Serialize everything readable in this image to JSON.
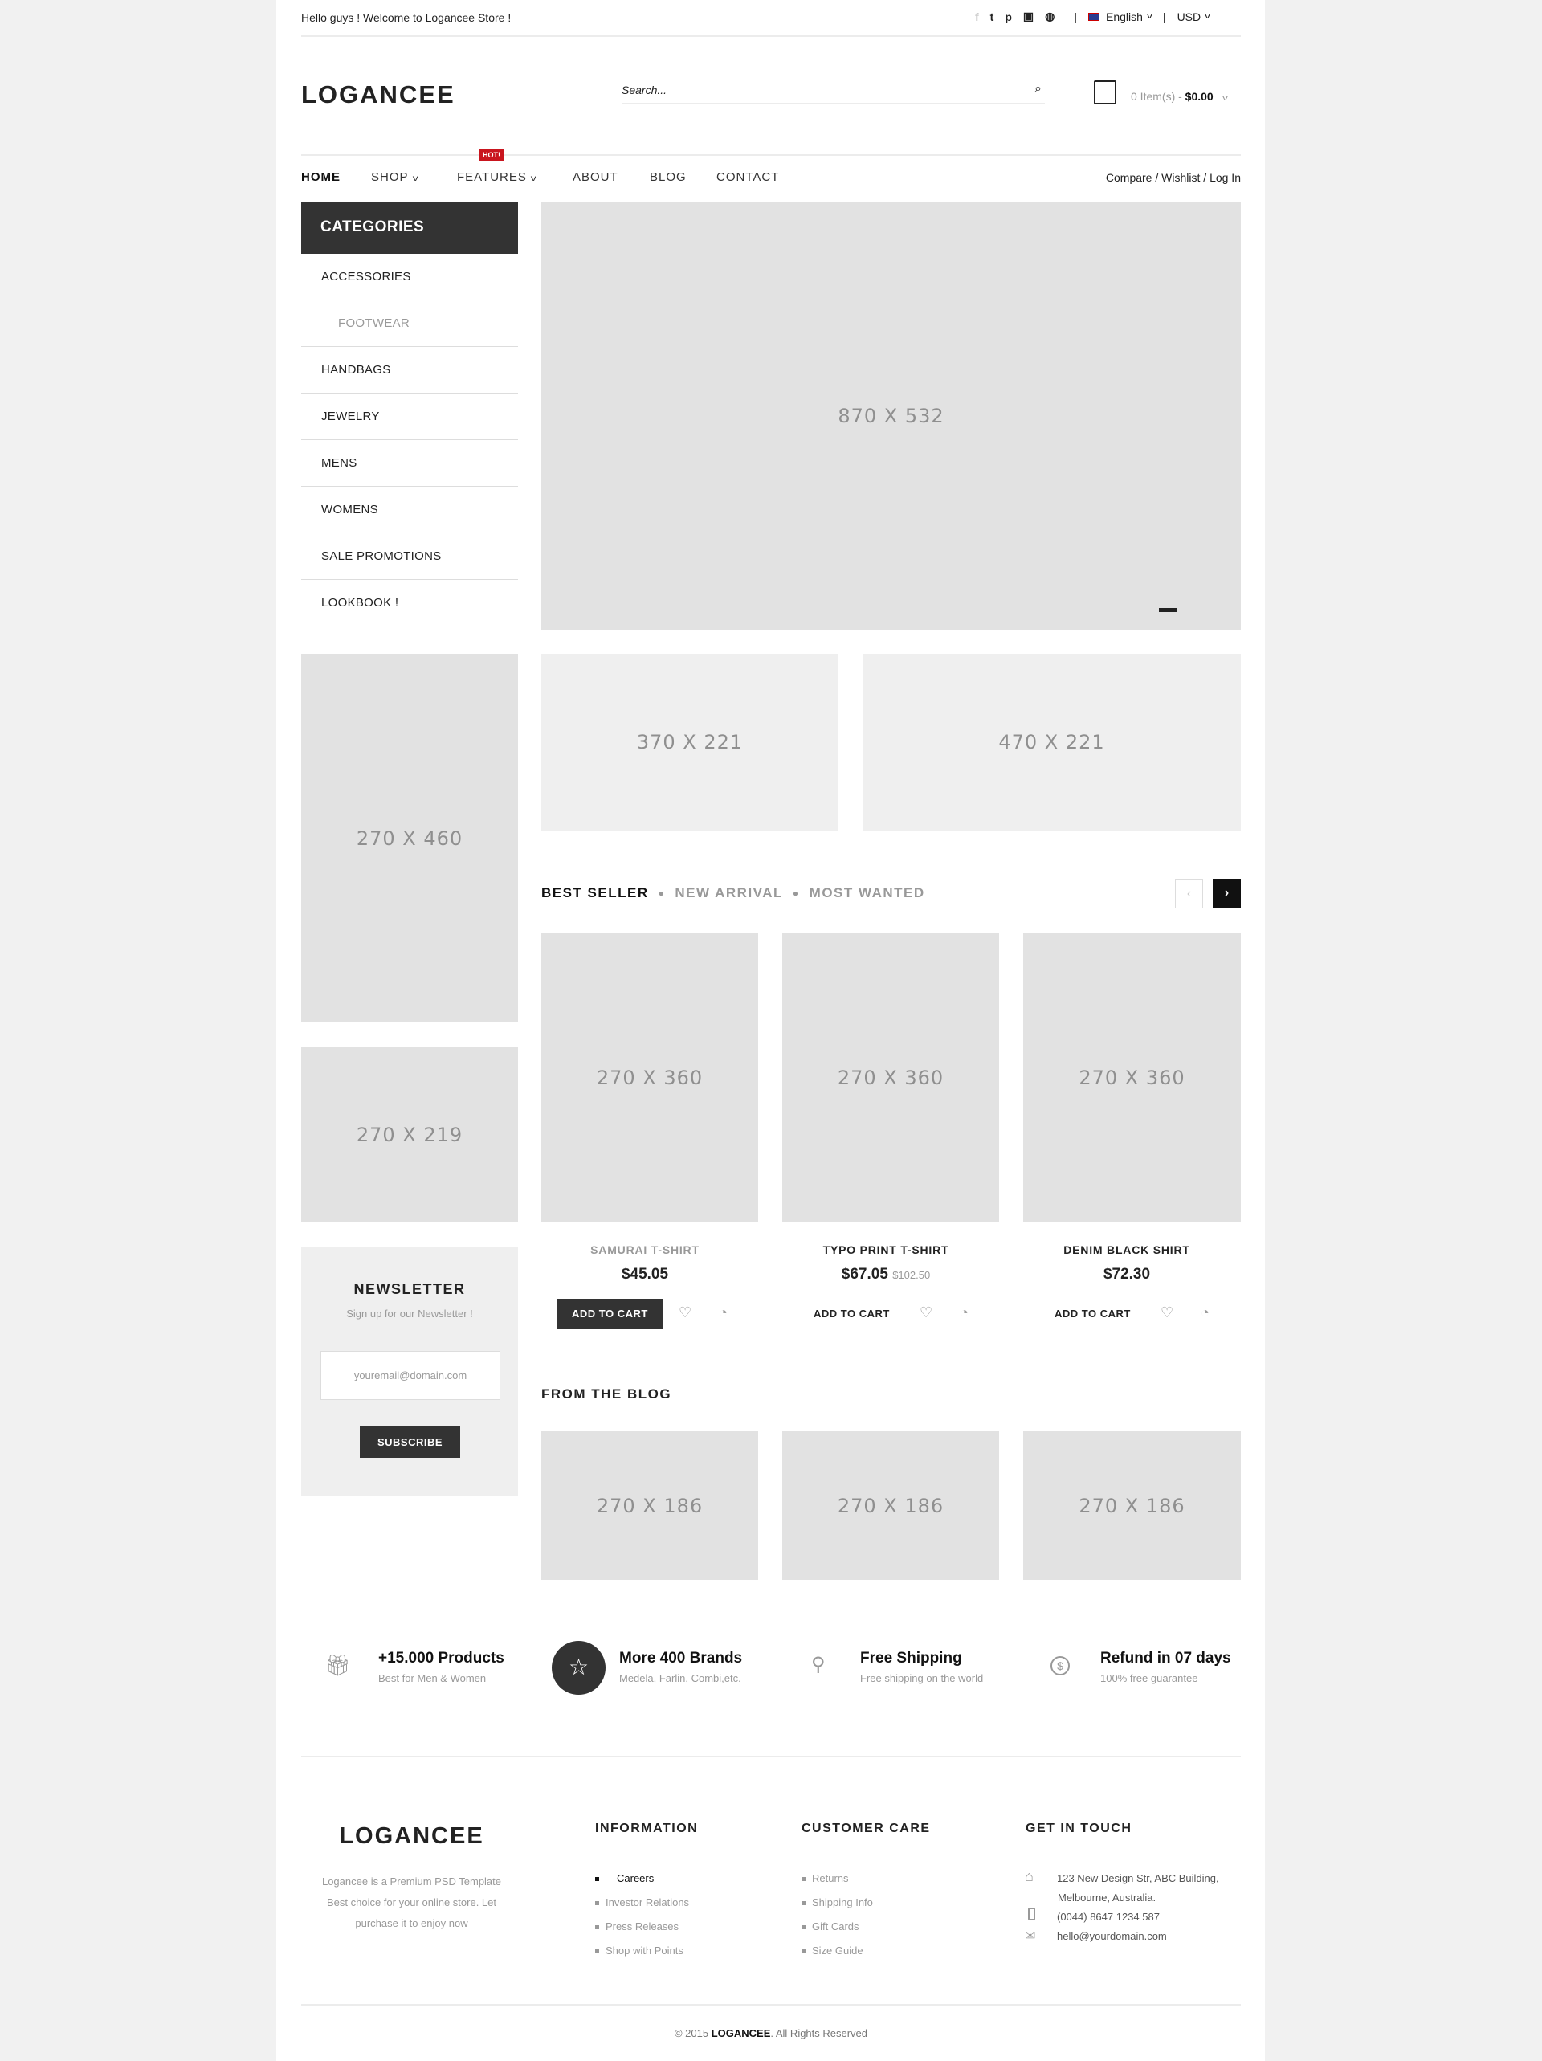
{
  "topbar": {
    "welcome": "Hello guys ! Welcome to Logancee Store !",
    "socials": [
      "facebook-icon",
      "twitter-icon",
      "pinterest-icon",
      "instagram-icon",
      "dribbble-icon"
    ],
    "language": "English",
    "currency": "USD"
  },
  "header": {
    "logo": "LOGANCEE",
    "search_placeholder": "Search...",
    "cart_items": "0 Item(s) - ",
    "cart_total": "$0.00"
  },
  "nav": {
    "items": [
      "HOME",
      "SHOP",
      "FEATURES",
      "ABOUT",
      "BLOG",
      "CONTACT"
    ],
    "hot_badge": "HOT!",
    "compare": "Compare",
    "wishlist": "Wishlist",
    "login": "Log In",
    "sep": "/"
  },
  "sidebar": {
    "title": "CATEGORIES",
    "items": [
      "ACCESSORIES",
      "FOOTWEAR",
      "HANDBAGS",
      "JEWELRY",
      "MENS",
      "WOMENS",
      "SALE PROMOTIONS",
      "LOOKBOOK !"
    ]
  },
  "banners": {
    "hero": "870 X 532",
    "small1": "370 X 221",
    "small2": "470 X 221",
    "side1": "270 X 460",
    "side2": "270 X 219"
  },
  "products": {
    "tabs": [
      "BEST SELLER",
      "NEW ARRIVAL",
      "MOST WANTED"
    ],
    "items": [
      {
        "image": "270 X 360",
        "name": "SAMURAI T-SHIRT",
        "price": "$45.05",
        "old_price": ""
      },
      {
        "image": "270 X 360",
        "name": "TYPO PRINT T-SHIRT",
        "price": "$67.05",
        "old_price": "$102.50"
      },
      {
        "image": "270 X 360",
        "name": "DENIM BLACK SHIRT",
        "price": "$72.30",
        "old_price": ""
      }
    ],
    "add_to_cart": "ADD TO CART"
  },
  "newsletter": {
    "title": "NEWSLETTER",
    "subtitle": "Sign up for our Newsletter !",
    "placeholder": "youremail@domain.com",
    "button": "SUBSCRIBE"
  },
  "blog": {
    "title": "FROM THE BLOG",
    "images": [
      "270 X 186",
      "270 X 186",
      "270 X 186"
    ]
  },
  "features": [
    {
      "icon": "gift-icon",
      "title": "+15.000 Products",
      "sub": "Best for Men & Women"
    },
    {
      "icon": "star-icon",
      "title": "More 400 Brands",
      "sub": "Medela, Farlin, Combi,etc."
    },
    {
      "icon": "map-pin-icon",
      "title": "Free Shipping",
      "sub": "Free shipping on the world"
    },
    {
      "icon": "dollar-icon",
      "title": "Refund in 07 days",
      "sub": "100% free guarantee"
    }
  ],
  "footer": {
    "logo": "LOGANCEE",
    "about": [
      "Logancee is a Premium PSD Template",
      "Best choice for your online store. Let",
      "purchase it to enjoy now"
    ],
    "information": {
      "title": "INFORMATION",
      "links": [
        "Careers",
        "Investor Relations",
        "Press Releases",
        "Shop with Points"
      ]
    },
    "customer_care": {
      "title": "CUSTOMER CARE",
      "links": [
        "Returns",
        "Shipping Info",
        "Gift Cards",
        "Size Guide"
      ]
    },
    "contact": {
      "title": "GET IN TOUCH",
      "address1": "123 New Design Str, ABC Building,",
      "address2": "Melbourne, Australia.",
      "phone": "(0044) 8647 1234 587",
      "email": "hello@yourdomain.com"
    },
    "copyright_pre": "© 2015 ",
    "copyright_brand": "LOGANCEE",
    "copyright_post": ". All Rights Reserved"
  }
}
